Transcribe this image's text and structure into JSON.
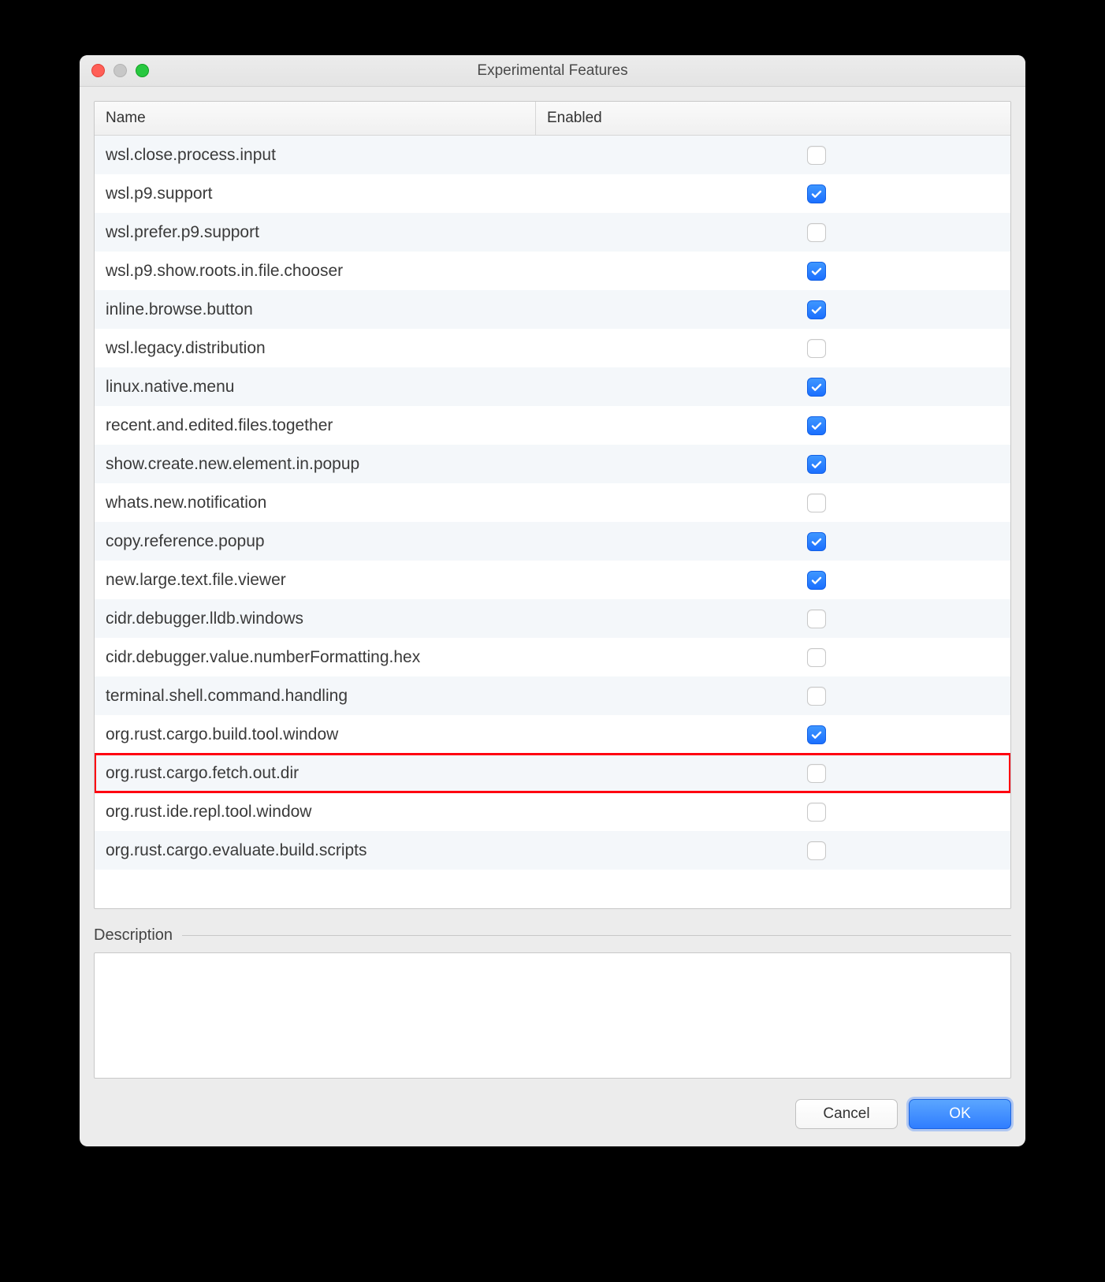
{
  "window": {
    "title": "Experimental Features"
  },
  "table": {
    "columns": {
      "name": "Name",
      "enabled": "Enabled"
    },
    "rows": [
      {
        "name": "wsl.close.process.input",
        "enabled": false,
        "highlight": false
      },
      {
        "name": "wsl.p9.support",
        "enabled": true,
        "highlight": false
      },
      {
        "name": "wsl.prefer.p9.support",
        "enabled": false,
        "highlight": false
      },
      {
        "name": "wsl.p9.show.roots.in.file.chooser",
        "enabled": true,
        "highlight": false
      },
      {
        "name": "inline.browse.button",
        "enabled": true,
        "highlight": false
      },
      {
        "name": "wsl.legacy.distribution",
        "enabled": false,
        "highlight": false
      },
      {
        "name": "linux.native.menu",
        "enabled": true,
        "highlight": false
      },
      {
        "name": "recent.and.edited.files.together",
        "enabled": true,
        "highlight": false
      },
      {
        "name": "show.create.new.element.in.popup",
        "enabled": true,
        "highlight": false
      },
      {
        "name": "whats.new.notification",
        "enabled": false,
        "highlight": false
      },
      {
        "name": "copy.reference.popup",
        "enabled": true,
        "highlight": false
      },
      {
        "name": "new.large.text.file.viewer",
        "enabled": true,
        "highlight": false
      },
      {
        "name": "cidr.debugger.lldb.windows",
        "enabled": false,
        "highlight": false
      },
      {
        "name": "cidr.debugger.value.numberFormatting.hex",
        "enabled": false,
        "highlight": false
      },
      {
        "name": "terminal.shell.command.handling",
        "enabled": false,
        "highlight": false
      },
      {
        "name": "org.rust.cargo.build.tool.window",
        "enabled": true,
        "highlight": false
      },
      {
        "name": "org.rust.cargo.fetch.out.dir",
        "enabled": false,
        "highlight": true
      },
      {
        "name": "org.rust.ide.repl.tool.window",
        "enabled": false,
        "highlight": false
      },
      {
        "name": "org.rust.cargo.evaluate.build.scripts",
        "enabled": false,
        "highlight": false
      }
    ]
  },
  "description": {
    "label": "Description",
    "text": ""
  },
  "buttons": {
    "cancel": "Cancel",
    "ok": "OK"
  }
}
